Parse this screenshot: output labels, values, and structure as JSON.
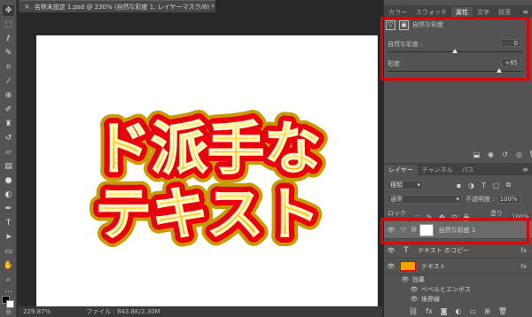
{
  "document": {
    "tab_title": "名称未設定 1.psd @ 230% (自然な彩度 1, レイヤーマスク/8) *",
    "close_glyph": "×",
    "artwork_line1": "ド派手な",
    "artwork_line2": "テキスト"
  },
  "status_bar": {
    "zoom": "229.87%",
    "file_info": "ファイル : 843.8K/2.30M"
  },
  "properties_panel": {
    "tabs": [
      "カラー",
      "スウォッチ",
      "属性",
      "文字",
      "段落"
    ],
    "active_tab": "属性",
    "adjustment_name": "自然な彩度",
    "vibrance_label": "自然な彩度 :",
    "vibrance_value": "0",
    "vibrance_level": 0.5,
    "saturation_label": "彩度 :",
    "saturation_value": "+65",
    "saturation_level": 0.83
  },
  "layers_panel": {
    "tabs": [
      "レイヤー",
      "チャンネル",
      "パス"
    ],
    "active_tab": "レイヤー",
    "filter_kind": "種類",
    "blend_mode": "通常",
    "opacity_label": "不透明度 :",
    "opacity_value": "100%",
    "lock_label": "ロック :",
    "fill_label": "塗り :",
    "fill_value": "100%",
    "layers": [
      {
        "name": "自然な彩度 1",
        "selected": true
      },
      {
        "name": "テキスト のコピー",
        "fx": "fx"
      },
      {
        "name": "テキスト",
        "fx": "fx"
      },
      {
        "name": "効果"
      },
      {
        "name": "ベベルとエンボス"
      },
      {
        "name": "境界線"
      }
    ]
  },
  "colors": {
    "highlight": "#e20000",
    "panel_bg": "#535353",
    "workspace_bg": "#282828",
    "text_fill_top": "#fff35a",
    "text_fill_bottom": "#f29600",
    "text_outline": "#e8000f"
  },
  "icons": {
    "toolbar": [
      "move-icon",
      "marquee-icon",
      "lasso-icon",
      "quick-select-icon",
      "crop-icon",
      "eyedropper-icon",
      "healing-icon",
      "brush-icon",
      "stamp-icon",
      "history-brush-icon",
      "eraser-icon",
      "gradient-icon",
      "blur-icon",
      "dodge-icon",
      "pen-icon",
      "type-icon",
      "path-select-icon",
      "shape-icon",
      "hand-icon",
      "zoom-icon",
      "more-icon"
    ],
    "properties_footer": [
      "clip-icon",
      "view-previous-icon",
      "reset-icon",
      "visibility-icon",
      "trash-icon"
    ],
    "layers_footer": [
      "link-icon",
      "fx-icon",
      "mask-icon",
      "adjustment-icon",
      "group-icon",
      "new-layer-icon",
      "trash-icon"
    ]
  }
}
